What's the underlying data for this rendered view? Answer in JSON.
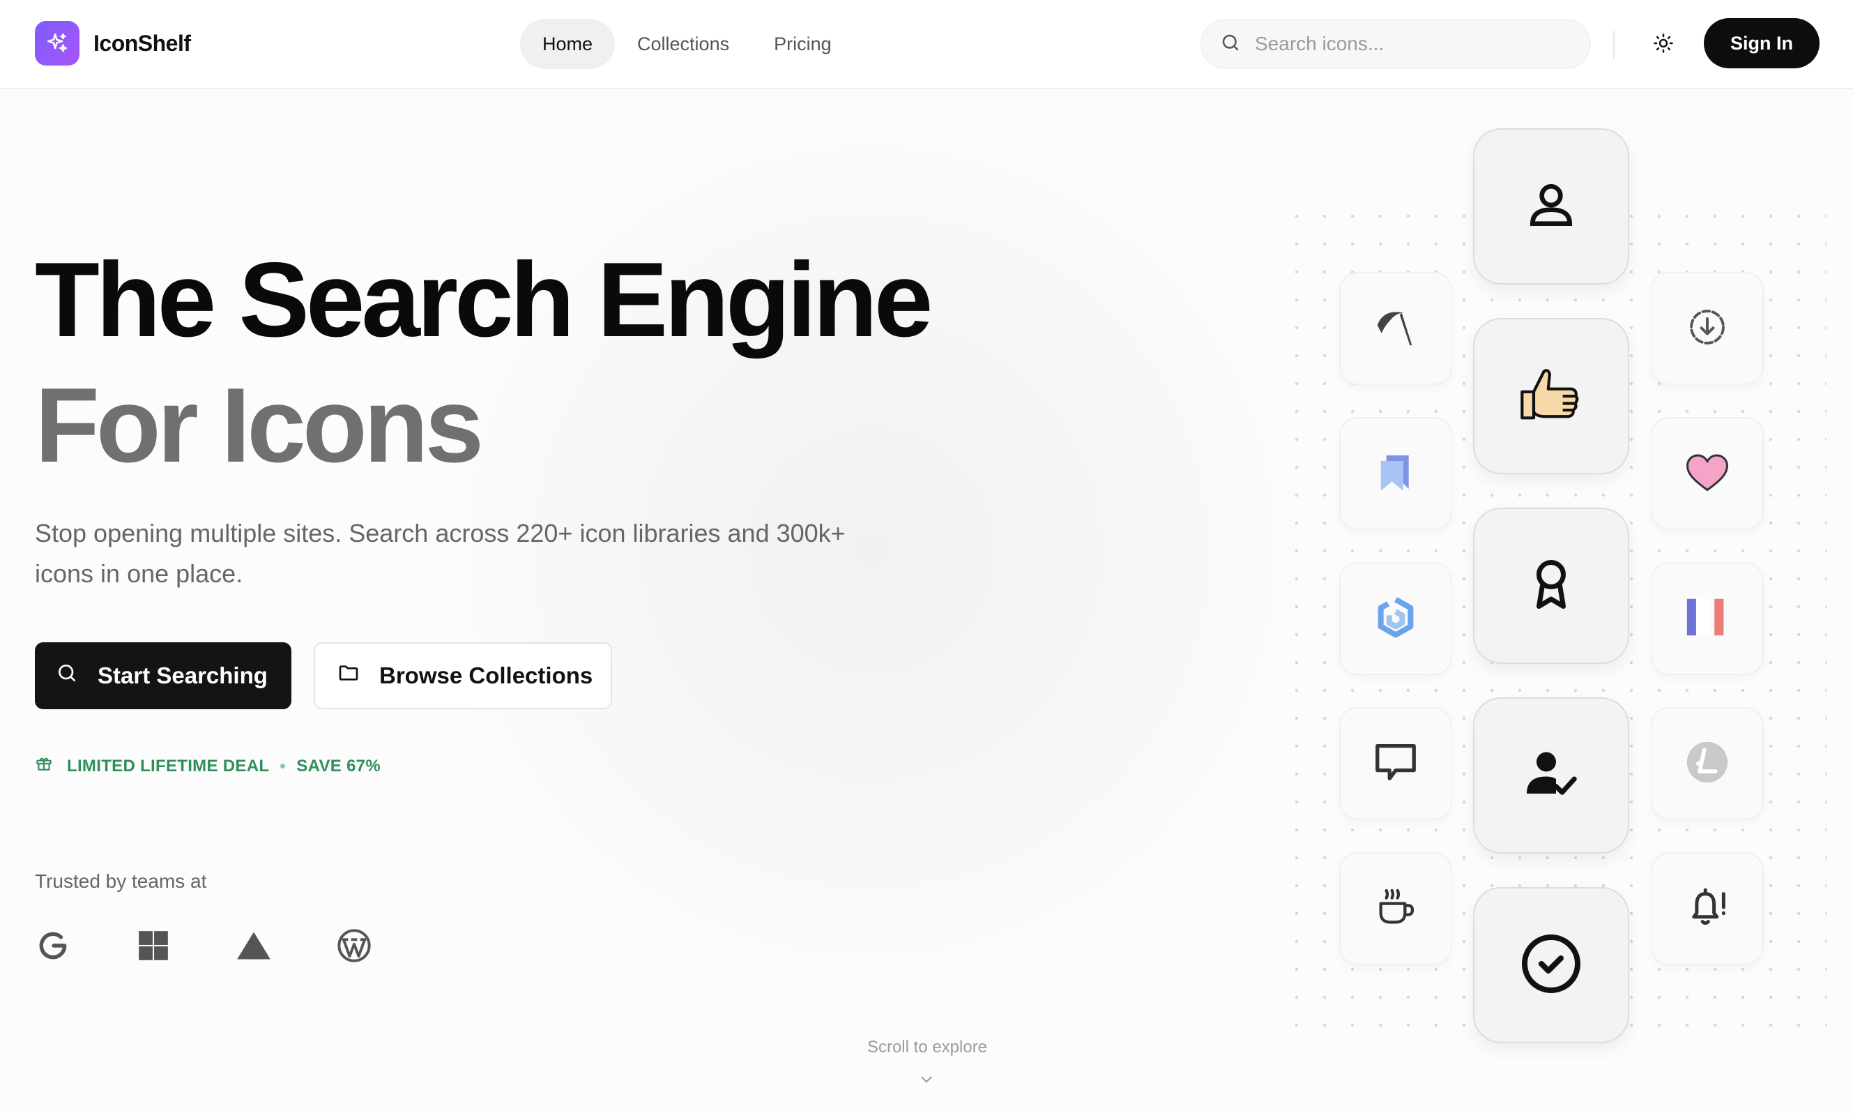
{
  "header": {
    "brand": "IconShelf",
    "nav": [
      {
        "label": "Home",
        "active": true
      },
      {
        "label": "Collections",
        "active": false
      },
      {
        "label": "Pricing",
        "active": false
      }
    ],
    "search_placeholder": "Search icons...",
    "signin_label": "Sign In"
  },
  "hero": {
    "title_line1": "The Search Engine",
    "title_line2": "For Icons",
    "subtitle": "Stop opening multiple sites. Search across 220+ icon libraries and 300k+ icons in one place.",
    "primary_cta": "Start Searching",
    "secondary_cta": "Browse Collections",
    "deal_label": "LIMITED LIFETIME DEAL",
    "deal_save": "SAVE 67%",
    "trusted_label": "Trusted by teams at",
    "brands": [
      "google-logo",
      "windows-logo",
      "vercel-logo",
      "wordpress-logo"
    ],
    "scroll_label": "Scroll to explore"
  },
  "icon_showcase": {
    "center_column": [
      "user-icon",
      "thumbs-up-icon",
      "award-ribbon-icon",
      "user-check-icon",
      "check-circle-icon"
    ],
    "left_column": [
      "scythe-icon",
      "bookmarks-icon",
      "hexagon-logo-icon",
      "message-square-icon",
      "hot-coffee-icon"
    ],
    "right_column": [
      "download-circle-icon",
      "pink-heart-icon",
      "france-flag-icon",
      "litecoin-icon",
      "bell-alert-icon"
    ]
  },
  "colors": {
    "accent_purple": "#7c5cff",
    "deal_green": "#2f8f5b",
    "primary_dark": "#141414"
  }
}
